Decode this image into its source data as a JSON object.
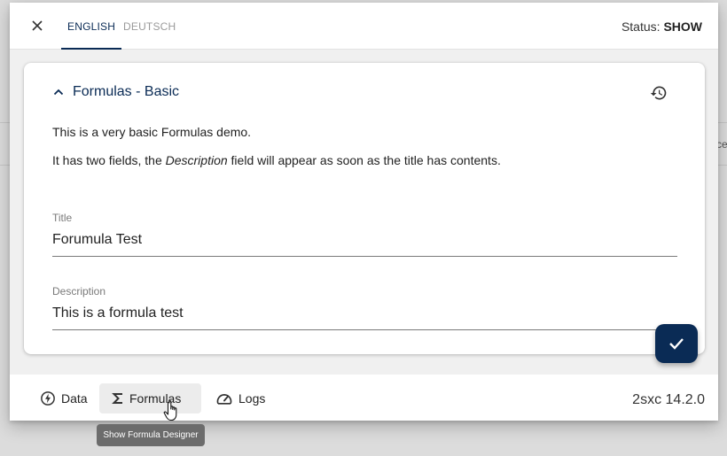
{
  "header": {
    "tabs": [
      {
        "label": "ENGLISH",
        "active": true
      },
      {
        "label": "DEUTSCH",
        "active": false
      }
    ],
    "status_label": "Status:",
    "status_value": "SHOW"
  },
  "card": {
    "title": "Formulas - Basic",
    "intro": "This is a very basic Formulas demo.",
    "note_before": "It has two fields, the ",
    "note_em": "Description",
    "note_after": " field will appear as soon as the title has contents.",
    "fields": [
      {
        "label": "Title",
        "value": "Forumula Test"
      },
      {
        "label": "Description",
        "value": "This is a formula test"
      }
    ]
  },
  "footer": {
    "buttons": [
      {
        "label": "Data",
        "icon": "bolt-icon"
      },
      {
        "label": "Formulas",
        "icon": "sigma-icon"
      },
      {
        "label": "Logs",
        "icon": "speedometer-icon"
      }
    ],
    "version": "2sxc 14.2.0"
  },
  "tooltip": "Show Formula Designer",
  "backdrop_fragment": "ce",
  "colors": {
    "primary": "#0a2b55",
    "tooltip_bg": "#6c6c6c"
  }
}
